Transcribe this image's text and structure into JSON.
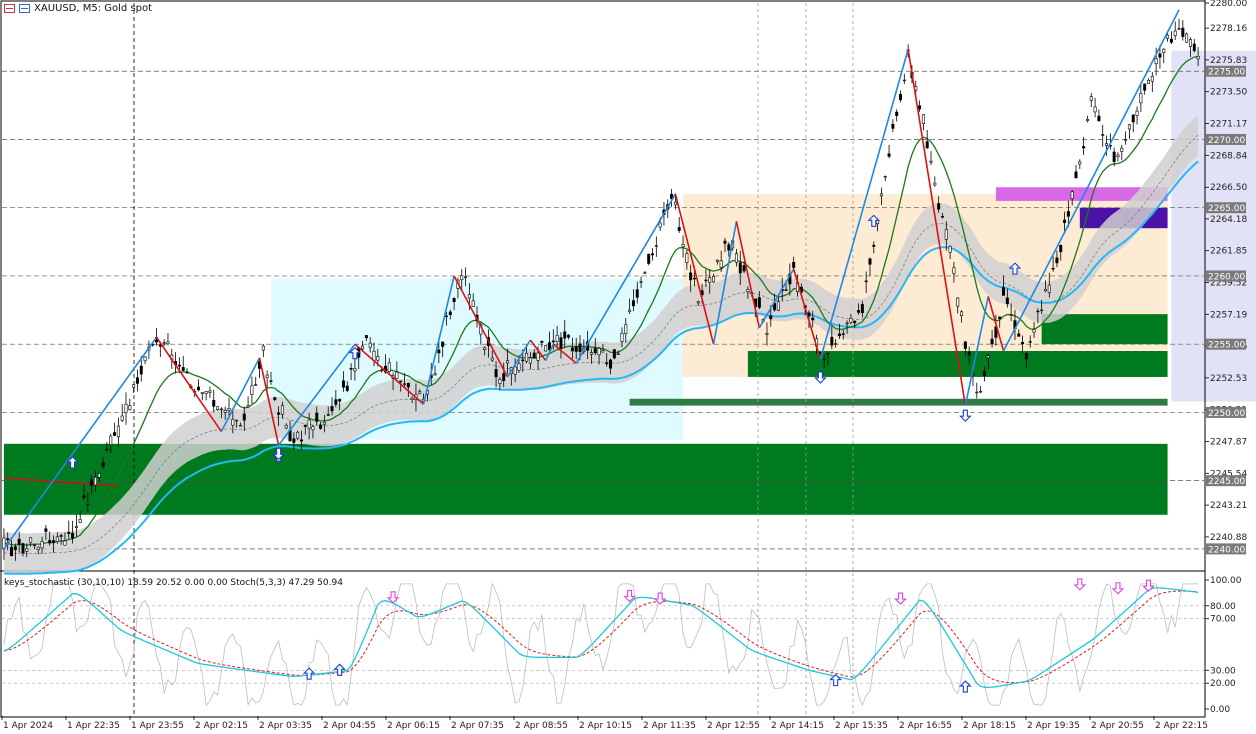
{
  "header": {
    "symbol_label": "XAUUSD, M5:  Gold spot",
    "icons": [
      "chart-menu-icon",
      "chart-properties-icon"
    ]
  },
  "indicator_header": "keys_stochastic (30,10,10) 18.59 20.52 0.00 0.00 Stoch(5,3,3) 47.29 50.94",
  "price_axis": {
    "min": 2238.6,
    "max": 2280.0,
    "ticks": [
      "2280.00",
      "2278.16",
      "2275.83",
      "2273.50",
      "2271.17",
      "2268.84",
      "2266.50",
      "2264.18",
      "2261.85",
      "2259.52",
      "2257.19",
      "2254.86",
      "2252.53",
      "2250.21",
      "2247.87",
      "2245.54",
      "2243.21",
      "2240.88"
    ],
    "tick_values": [
      2280.0,
      2278.16,
      2275.83,
      2273.5,
      2271.17,
      2268.84,
      2266.5,
      2264.18,
      2261.85,
      2259.52,
      2257.19,
      2254.86,
      2252.53,
      2250.21,
      2247.87,
      2245.54,
      2243.21,
      2240.88
    ],
    "level_labels": [
      "2275.00",
      "2270.00",
      "2265.00",
      "2260.00",
      "2255.00",
      "2250.00",
      "2245.00",
      "2240.00"
    ],
    "level_values": [
      2275.0,
      2270.0,
      2265.0,
      2260.0,
      2255.0,
      2250.0,
      2245.0,
      2240.0
    ],
    "level_label_bg": "#7a7a7a"
  },
  "stoch_axis": {
    "ticks": [
      "100.00",
      "80.00",
      "70.00",
      "30.00",
      "20.00",
      "0.00"
    ],
    "tick_values": [
      100,
      80,
      70,
      30,
      20,
      0
    ]
  },
  "time_axis": {
    "labels": [
      "1 Apr 2024",
      "1 Apr 22:35",
      "1 Apr 23:55",
      "2 Apr 02:15",
      "2 Apr 03:35",
      "2 Apr 04:55",
      "2 Apr 06:15",
      "2 Apr 07:35",
      "2 Apr 08:55",
      "2 Apr 10:15",
      "2 Apr 11:35",
      "2 Apr 12:55",
      "2 Apr 14:15",
      "2 Apr 15:35",
      "2 Apr 16:55",
      "2 Apr 18:15",
      "2 Apr 19:35",
      "2 Apr 20:55",
      "2 Apr 22:15"
    ]
  },
  "colors": {
    "bull_zigzag": "#1e88e5",
    "bear_zigzag": "#e01010",
    "ma_green": "#1a7a1a",
    "ma_blue": "#29b6f6",
    "zone_green": "#007a1e",
    "zone_light_cyan": "#e0fbff",
    "zone_peach": "#fdebd3",
    "zone_lavender": "#e2e2f7",
    "zone_magenta": "#d968e6",
    "zone_purple": "#4a12a8",
    "stoch_main": "#1ec8d8",
    "stoch_signal": "#e02020",
    "stoch_grey": "#bdbdbd",
    "arrow_up": "#1a3fd6",
    "arrow_down": "#e040e0"
  },
  "chart_data": {
    "type": "candlestick",
    "symbol": "XAUUSD",
    "timeframe": "M5",
    "price_pivots": [
      {
        "i": 0,
        "p": 2240.0
      },
      {
        "i": 18,
        "p": 2241.2
      },
      {
        "i": 40,
        "p": 2255.5
      },
      {
        "i": 55,
        "p": 2250.5
      },
      {
        "i": 62,
        "p": 2249.0
      },
      {
        "i": 68,
        "p": 2254.0
      },
      {
        "i": 75,
        "p": 2248.0
      },
      {
        "i": 85,
        "p": 2249.5
      },
      {
        "i": 95,
        "p": 2255.0
      },
      {
        "i": 110,
        "p": 2250.8
      },
      {
        "i": 120,
        "p": 2260.0
      },
      {
        "i": 130,
        "p": 2252.5
      },
      {
        "i": 145,
        "p": 2255.3
      },
      {
        "i": 160,
        "p": 2253.8
      },
      {
        "i": 175,
        "p": 2266.0
      },
      {
        "i": 182,
        "p": 2258.0
      },
      {
        "i": 190,
        "p": 2262.5
      },
      {
        "i": 200,
        "p": 2256.5
      },
      {
        "i": 207,
        "p": 2260.5
      },
      {
        "i": 215,
        "p": 2253.8
      },
      {
        "i": 225,
        "p": 2258.0
      },
      {
        "i": 237,
        "p": 2276.5
      },
      {
        "i": 247,
        "p": 2263.0
      },
      {
        "i": 255,
        "p": 2251.0
      },
      {
        "i": 262,
        "p": 2258.5
      },
      {
        "i": 268,
        "p": 2254.5
      },
      {
        "i": 275,
        "p": 2260.0
      },
      {
        "i": 285,
        "p": 2272.5
      },
      {
        "i": 292,
        "p": 2268.5
      },
      {
        "i": 300,
        "p": 2274.5
      },
      {
        "i": 308,
        "p": 2278.5
      },
      {
        "i": 313,
        "p": 2276.0
      }
    ],
    "zigzag": [
      {
        "i": 0,
        "p": 2240.0
      },
      {
        "i": 40,
        "p": 2255.5
      },
      {
        "i": 57,
        "p": 2248.6
      },
      {
        "i": 67,
        "p": 2254.0
      },
      {
        "i": 72,
        "p": 2247.6
      },
      {
        "i": 92,
        "p": 2255.0
      },
      {
        "i": 110,
        "p": 2250.6
      },
      {
        "i": 118,
        "p": 2260.0
      },
      {
        "i": 132,
        "p": 2252.6
      },
      {
        "i": 138,
        "p": 2255.3
      },
      {
        "i": 142,
        "p": 2253.8
      },
      {
        "i": 144,
        "p": 2255.0
      },
      {
        "i": 150,
        "p": 2253.6
      },
      {
        "i": 176,
        "p": 2266.0
      },
      {
        "i": 186,
        "p": 2255.0
      },
      {
        "i": 192,
        "p": 2264.0
      },
      {
        "i": 198,
        "p": 2256.2
      },
      {
        "i": 207,
        "p": 2260.5
      },
      {
        "i": 214,
        "p": 2253.9
      },
      {
        "i": 237,
        "p": 2276.6
      },
      {
        "i": 252,
        "p": 2250.5
      },
      {
        "i": 258,
        "p": 2258.5
      },
      {
        "i": 262,
        "p": 2254.5
      },
      {
        "i": 308,
        "p": 2279.5
      }
    ],
    "zones": [
      {
        "type": "demand",
        "price_top": 2247.7,
        "price_bottom": 2242.5
      },
      {
        "type": "demand",
        "price_top": 2254.5,
        "price_bottom": 2252.6
      },
      {
        "type": "demand",
        "price_top": 2257.2,
        "price_bottom": 2255.0
      },
      {
        "type": "demand",
        "price_top": 2251.0,
        "price_bottom": 2250.5
      },
      {
        "type": "supply",
        "price_top": 2266.5,
        "price_bottom": 2265.5
      },
      {
        "type": "supply",
        "price_top": 2265.0,
        "price_bottom": 2263.5
      }
    ],
    "stochastic": {
      "main_params": "30,10,10",
      "main_value": 18.59,
      "signal_value": 20.52,
      "stoch_params": "5,3,3",
      "stoch_main": 47.29,
      "stoch_signal": 50.94,
      "levels": [
        80,
        70,
        30,
        20
      ],
      "main_pivots": [
        {
          "i": 0,
          "v": 45
        },
        {
          "i": 18,
          "v": 92
        },
        {
          "i": 30,
          "v": 60
        },
        {
          "i": 50,
          "v": 35
        },
        {
          "i": 75,
          "v": 25
        },
        {
          "i": 90,
          "v": 30
        },
        {
          "i": 98,
          "v": 88
        },
        {
          "i": 108,
          "v": 70
        },
        {
          "i": 120,
          "v": 85
        },
        {
          "i": 135,
          "v": 40
        },
        {
          "i": 150,
          "v": 40
        },
        {
          "i": 165,
          "v": 88
        },
        {
          "i": 180,
          "v": 80
        },
        {
          "i": 195,
          "v": 45
        },
        {
          "i": 210,
          "v": 30
        },
        {
          "i": 222,
          "v": 22
        },
        {
          "i": 240,
          "v": 88
        },
        {
          "i": 255,
          "v": 15
        },
        {
          "i": 268,
          "v": 22
        },
        {
          "i": 285,
          "v": 55
        },
        {
          "i": 300,
          "v": 95
        },
        {
          "i": 313,
          "v": 90
        }
      ]
    },
    "markers": {
      "price_up": [
        {
          "i": 18,
          "p": 2246.3
        },
        {
          "i": 72,
          "p": 2246.8
        },
        {
          "i": 92,
          "p": 2254.3
        },
        {
          "i": 228,
          "p": 2264.0
        },
        {
          "i": 265,
          "p": 2260.5
        }
      ],
      "price_down": [
        {
          "i": 72,
          "p": 2247.0
        },
        {
          "i": 214,
          "p": 2252.6
        },
        {
          "i": 252,
          "p": 2249.8
        }
      ],
      "stoch_up": [
        {
          "i": 80,
          "v": 27
        },
        {
          "i": 88,
          "v": 30
        },
        {
          "i": 218,
          "v": 22
        },
        {
          "i": 252,
          "v": 17
        }
      ],
      "stoch_down": [
        {
          "i": 102,
          "v": 87
        },
        {
          "i": 164,
          "v": 88
        },
        {
          "i": 172,
          "v": 86
        },
        {
          "i": 235,
          "v": 86
        },
        {
          "i": 282,
          "v": 97
        },
        {
          "i": 292,
          "v": 94
        },
        {
          "i": 300,
          "v": 96
        }
      ]
    }
  }
}
